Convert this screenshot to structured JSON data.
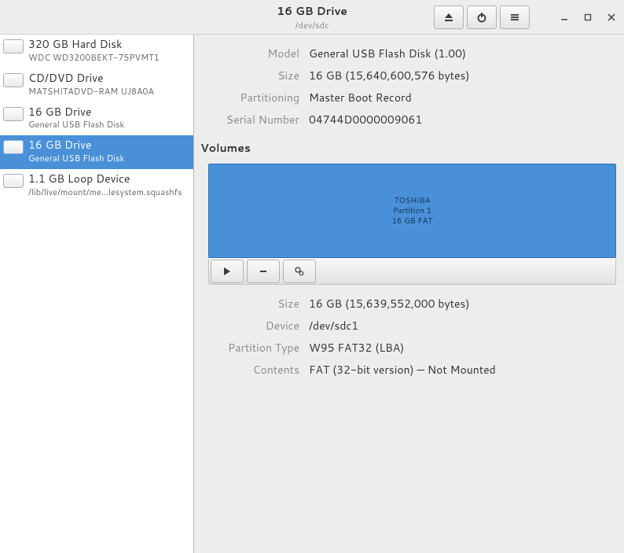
{
  "header": {
    "title": "16 GB Drive",
    "subtitle": "/dev/sdc"
  },
  "sidebar": {
    "items": [
      {
        "title": "320 GB Hard Disk",
        "sub": "WDC WD3200BEKT-75PVMT1"
      },
      {
        "title": "CD/DVD Drive",
        "sub": "MATSHITADVD-RAM UJ8A0A"
      },
      {
        "title": "16 GB Drive",
        "sub": "General USB Flash Disk"
      },
      {
        "title": "16 GB Drive",
        "sub": "General USB Flash Disk"
      },
      {
        "title": "1.1 GB Loop Device",
        "sub": "/lib/live/mount/me…lesystem.squashfs"
      }
    ]
  },
  "drive": {
    "model_label": "Model",
    "model": "General USB Flash Disk (1.00)",
    "size_label": "Size",
    "size": "16 GB (15,640,600,576 bytes)",
    "part_label": "Partitioning",
    "part": "Master Boot Record",
    "serial_label": "Serial Number",
    "serial": "04744D0000009061"
  },
  "volumes_title": "Volumes",
  "volume": {
    "name": "TOSHIBA",
    "line2": "Partition 1",
    "line3": "16 GB FAT"
  },
  "partition": {
    "size_label": "Size",
    "size": "16 GB (15,639,552,000 bytes)",
    "device_label": "Device",
    "device": "/dev/sdc1",
    "type_label": "Partition Type",
    "type": "W95 FAT32 (LBA)",
    "contents_label": "Contents",
    "contents": "FAT (32-bit version) — Not Mounted"
  }
}
